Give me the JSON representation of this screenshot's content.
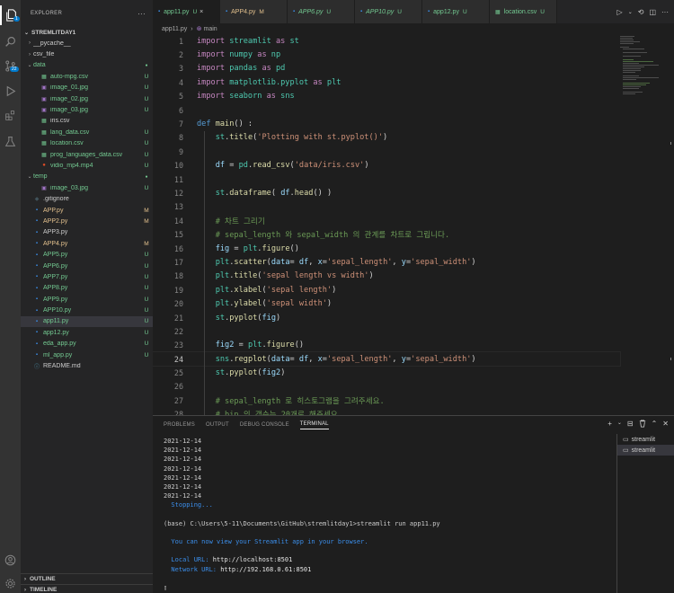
{
  "activity_bar": {
    "items": [
      {
        "icon": "files-icon"
      },
      {
        "icon": "search-icon"
      },
      {
        "icon": "source-control-icon",
        "badge": "22"
      },
      {
        "icon": "run-debug-icon"
      },
      {
        "icon": "extensions-icon"
      },
      {
        "icon": "flask-icon"
      }
    ],
    "bottom": [
      {
        "icon": "account-icon"
      },
      {
        "icon": "settings-gear-icon"
      }
    ]
  },
  "explorer": {
    "title": "EXPLORER",
    "project": "STREMLITDAY1",
    "tree": [
      {
        "depth": 1,
        "caret": "›",
        "name": "__pycache__",
        "kind": "folder",
        "color": "#ccc",
        "badge": ""
      },
      {
        "depth": 1,
        "caret": "›",
        "name": "csv_file",
        "kind": "folder",
        "color": "#ccc",
        "badge": ""
      },
      {
        "depth": 1,
        "caret": "⌄",
        "name": "data",
        "kind": "folder",
        "color": "#73c991",
        "badge": "●"
      },
      {
        "depth": 2,
        "caret": "",
        "name": "auto-mpg.csv",
        "kind": "csv",
        "color": "#73c991",
        "badge": "U"
      },
      {
        "depth": 2,
        "caret": "",
        "name": "image_01.jpg",
        "kind": "img",
        "color": "#73c991",
        "badge": "U"
      },
      {
        "depth": 2,
        "caret": "",
        "name": "image_02.jpg",
        "kind": "img",
        "color": "#73c991",
        "badge": "U"
      },
      {
        "depth": 2,
        "caret": "",
        "name": "image_03.jpg",
        "kind": "img",
        "color": "#73c991",
        "badge": "U"
      },
      {
        "depth": 2,
        "caret": "",
        "name": "iris.csv",
        "kind": "csv",
        "color": "#ccc",
        "badge": ""
      },
      {
        "depth": 2,
        "caret": "",
        "name": "lang_data.csv",
        "kind": "csv",
        "color": "#73c991",
        "badge": "U"
      },
      {
        "depth": 2,
        "caret": "",
        "name": "location.csv",
        "kind": "csv",
        "color": "#73c991",
        "badge": "U"
      },
      {
        "depth": 2,
        "caret": "",
        "name": "prog_languages_data.csv",
        "kind": "csv",
        "color": "#73c991",
        "badge": "U"
      },
      {
        "depth": 2,
        "caret": "",
        "name": "vidio_mp4.mp4",
        "kind": "vid",
        "color": "#73c991",
        "badge": "U"
      },
      {
        "depth": 1,
        "caret": "⌄",
        "name": "temp",
        "kind": "folder",
        "color": "#73c991",
        "badge": "●"
      },
      {
        "depth": 2,
        "caret": "",
        "name": "image_03.jpg",
        "kind": "img",
        "color": "#73c991",
        "badge": "U"
      },
      {
        "depth": 1,
        "caret": "",
        "name": ".gitignore",
        "kind": "git",
        "color": "#ccc",
        "badge": ""
      },
      {
        "depth": 1,
        "caret": "",
        "name": "APP.py",
        "kind": "py",
        "color": "#e2c08d",
        "badge": "M"
      },
      {
        "depth": 1,
        "caret": "",
        "name": "APP2.py",
        "kind": "py",
        "color": "#e2c08d",
        "badge": "M"
      },
      {
        "depth": 1,
        "caret": "",
        "name": "APP3.py",
        "kind": "py",
        "color": "#ccc",
        "badge": ""
      },
      {
        "depth": 1,
        "caret": "",
        "name": "APP4.py",
        "kind": "py",
        "color": "#e2c08d",
        "badge": "M"
      },
      {
        "depth": 1,
        "caret": "",
        "name": "APP5.py",
        "kind": "py",
        "color": "#73c991",
        "badge": "U"
      },
      {
        "depth": 1,
        "caret": "",
        "name": "APP6.py",
        "kind": "py",
        "color": "#73c991",
        "badge": "U"
      },
      {
        "depth": 1,
        "caret": "",
        "name": "APP7.py",
        "kind": "py",
        "color": "#73c991",
        "badge": "U"
      },
      {
        "depth": 1,
        "caret": "",
        "name": "APP8.py",
        "kind": "py",
        "color": "#73c991",
        "badge": "U"
      },
      {
        "depth": 1,
        "caret": "",
        "name": "APP9.py",
        "kind": "py",
        "color": "#73c991",
        "badge": "U"
      },
      {
        "depth": 1,
        "caret": "",
        "name": "APP10.py",
        "kind": "py",
        "color": "#73c991",
        "badge": "U"
      },
      {
        "depth": 1,
        "caret": "",
        "name": "app11.py",
        "kind": "py",
        "color": "#73c991",
        "badge": "U",
        "selected": true
      },
      {
        "depth": 1,
        "caret": "",
        "name": "app12.py",
        "kind": "py",
        "color": "#73c991",
        "badge": "U"
      },
      {
        "depth": 1,
        "caret": "",
        "name": "eda_app.py",
        "kind": "py",
        "color": "#73c991",
        "badge": "U"
      },
      {
        "depth": 1,
        "caret": "",
        "name": "ml_app.py",
        "kind": "py",
        "color": "#73c991",
        "badge": "U"
      },
      {
        "depth": 1,
        "caret": "",
        "name": "README.md",
        "kind": "info",
        "color": "#ccc",
        "badge": ""
      }
    ],
    "outline": "OUTLINE",
    "timeline": "TIMELINE"
  },
  "tabs": [
    {
      "label": "app11.py",
      "status": "U",
      "active": true,
      "close": "×"
    },
    {
      "label": "APP4.py",
      "status": "M",
      "active": false,
      "close": ""
    },
    {
      "label": "APP6.py",
      "status": "U",
      "active": false,
      "close": ""
    },
    {
      "label": "APP10.py",
      "status": "U",
      "active": false,
      "close": ""
    },
    {
      "label": "app12.py",
      "status": "U",
      "active": false,
      "close": ""
    },
    {
      "label": "location.csv",
      "status": "U",
      "active": false,
      "close": ""
    }
  ],
  "breadcrumb": {
    "file": "app11.py",
    "sep": "›",
    "symbol": "main"
  },
  "code": {
    "lines": [
      {
        "n": "1",
        "toks": [
          [
            "kw",
            "import "
          ],
          [
            "mod",
            "streamlit"
          ],
          [
            "kw",
            " as "
          ],
          [
            "mod",
            "st"
          ]
        ]
      },
      {
        "n": "2",
        "toks": [
          [
            "kw",
            "import "
          ],
          [
            "mod",
            "numpy"
          ],
          [
            "kw",
            " as "
          ],
          [
            "mod",
            "np"
          ]
        ]
      },
      {
        "n": "3",
        "toks": [
          [
            "kw",
            "import "
          ],
          [
            "mod",
            "pandas"
          ],
          [
            "kw",
            " as "
          ],
          [
            "mod",
            "pd"
          ]
        ]
      },
      {
        "n": "4",
        "toks": [
          [
            "kw",
            "import "
          ],
          [
            "mod",
            "matplotlib.pyplot"
          ],
          [
            "kw",
            " as "
          ],
          [
            "mod",
            "plt"
          ]
        ]
      },
      {
        "n": "5",
        "toks": [
          [
            "kw",
            "import "
          ],
          [
            "mod",
            "seaborn"
          ],
          [
            "kw",
            " as "
          ],
          [
            "mod",
            "sns"
          ]
        ]
      },
      {
        "n": "6",
        "toks": []
      },
      {
        "n": "7",
        "toks": [
          [
            "def",
            "def "
          ],
          [
            "fn",
            "main"
          ],
          [
            "id",
            "() :"
          ]
        ]
      },
      {
        "n": "8",
        "toks": [
          [
            "id",
            "    "
          ],
          [
            "mod",
            "st"
          ],
          [
            "id",
            "."
          ],
          [
            "fn",
            "title"
          ],
          [
            "id",
            "("
          ],
          [
            "str",
            "'Plotting with st.pyplot()'"
          ],
          [
            "id",
            ")"
          ]
        ]
      },
      {
        "n": "9",
        "toks": []
      },
      {
        "n": "10",
        "toks": [
          [
            "id",
            "    "
          ],
          [
            "var",
            "df"
          ],
          [
            "id",
            " = "
          ],
          [
            "mod",
            "pd"
          ],
          [
            "id",
            "."
          ],
          [
            "fn",
            "read_csv"
          ],
          [
            "id",
            "("
          ],
          [
            "str",
            "'data/iris.csv'"
          ],
          [
            "id",
            ")"
          ]
        ]
      },
      {
        "n": "11",
        "toks": []
      },
      {
        "n": "12",
        "toks": [
          [
            "id",
            "    "
          ],
          [
            "mod",
            "st"
          ],
          [
            "id",
            "."
          ],
          [
            "fn",
            "dataframe"
          ],
          [
            "id",
            "( "
          ],
          [
            "var",
            "df"
          ],
          [
            "id",
            "."
          ],
          [
            "fn",
            "head"
          ],
          [
            "id",
            "() )"
          ]
        ]
      },
      {
        "n": "13",
        "toks": []
      },
      {
        "n": "14",
        "toks": [
          [
            "cm",
            "    # 차트 그리기"
          ]
        ]
      },
      {
        "n": "15",
        "toks": [
          [
            "cm",
            "    # sepal_length 와 sepal_width 의 관계를 차트로 그립니다."
          ]
        ]
      },
      {
        "n": "16",
        "toks": [
          [
            "id",
            "    "
          ],
          [
            "var",
            "fig"
          ],
          [
            "id",
            " = "
          ],
          [
            "mod",
            "plt"
          ],
          [
            "id",
            "."
          ],
          [
            "fn",
            "figure"
          ],
          [
            "id",
            "()"
          ]
        ]
      },
      {
        "n": "17",
        "toks": [
          [
            "id",
            "    "
          ],
          [
            "mod",
            "plt"
          ],
          [
            "id",
            "."
          ],
          [
            "fn",
            "scatter"
          ],
          [
            "id",
            "("
          ],
          [
            "var",
            "data"
          ],
          [
            "id",
            "= "
          ],
          [
            "var",
            "df"
          ],
          [
            "id",
            ", "
          ],
          [
            "var",
            "x"
          ],
          [
            "id",
            "="
          ],
          [
            "str",
            "'sepal_length'"
          ],
          [
            "id",
            ", "
          ],
          [
            "var",
            "y"
          ],
          [
            "id",
            "="
          ],
          [
            "str",
            "'sepal_width'"
          ],
          [
            "id",
            ")"
          ]
        ]
      },
      {
        "n": "18",
        "toks": [
          [
            "id",
            "    "
          ],
          [
            "mod",
            "plt"
          ],
          [
            "id",
            "."
          ],
          [
            "fn",
            "title"
          ],
          [
            "id",
            "("
          ],
          [
            "str",
            "'sepal length vs width'"
          ],
          [
            "id",
            ")"
          ]
        ]
      },
      {
        "n": "19",
        "toks": [
          [
            "id",
            "    "
          ],
          [
            "mod",
            "plt"
          ],
          [
            "id",
            "."
          ],
          [
            "fn",
            "xlabel"
          ],
          [
            "id",
            "("
          ],
          [
            "str",
            "'sepal length'"
          ],
          [
            "id",
            ")"
          ]
        ]
      },
      {
        "n": "20",
        "toks": [
          [
            "id",
            "    "
          ],
          [
            "mod",
            "plt"
          ],
          [
            "id",
            "."
          ],
          [
            "fn",
            "ylabel"
          ],
          [
            "id",
            "("
          ],
          [
            "str",
            "'sepal width'"
          ],
          [
            "id",
            ")"
          ]
        ]
      },
      {
        "n": "21",
        "toks": [
          [
            "id",
            "    "
          ],
          [
            "mod",
            "st"
          ],
          [
            "id",
            "."
          ],
          [
            "fn",
            "pyplot"
          ],
          [
            "id",
            "("
          ],
          [
            "var",
            "fig"
          ],
          [
            "id",
            ")"
          ]
        ]
      },
      {
        "n": "22",
        "toks": []
      },
      {
        "n": "23",
        "toks": [
          [
            "id",
            "    "
          ],
          [
            "var",
            "fig2"
          ],
          [
            "id",
            " = "
          ],
          [
            "mod",
            "plt"
          ],
          [
            "id",
            "."
          ],
          [
            "fn",
            "figure"
          ],
          [
            "id",
            "()"
          ]
        ]
      },
      {
        "n": "24",
        "cur": true,
        "toks": [
          [
            "id",
            "    "
          ],
          [
            "mod",
            "sns"
          ],
          [
            "id",
            "."
          ],
          [
            "fn",
            "regplot"
          ],
          [
            "id",
            "("
          ],
          [
            "var",
            "data"
          ],
          [
            "id",
            "= "
          ],
          [
            "var",
            "df"
          ],
          [
            "id",
            ", "
          ],
          [
            "var",
            "x"
          ],
          [
            "id",
            "="
          ],
          [
            "str",
            "'sepal_length'"
          ],
          [
            "id",
            ", "
          ],
          [
            "var",
            "y"
          ],
          [
            "id",
            "="
          ],
          [
            "str",
            "'sepal_width'"
          ],
          [
            "id",
            ")"
          ]
        ]
      },
      {
        "n": "25",
        "toks": [
          [
            "id",
            "    "
          ],
          [
            "mod",
            "st"
          ],
          [
            "id",
            "."
          ],
          [
            "fn",
            "pyplot"
          ],
          [
            "id",
            "("
          ],
          [
            "var",
            "fig2"
          ],
          [
            "id",
            ")"
          ]
        ]
      },
      {
        "n": "26",
        "toks": []
      },
      {
        "n": "27",
        "toks": [
          [
            "cm",
            "    # sepal_length 로 히스토그램을 그려주세요."
          ]
        ]
      },
      {
        "n": "28",
        "toks": [
          [
            "cm",
            "    # bin 의 갯수는 20개로 해주세요."
          ]
        ]
      }
    ]
  },
  "panel": {
    "tabs": [
      "PROBLEMS",
      "OUTPUT",
      "DEBUG CONSOLE",
      "TERMINAL"
    ],
    "active_tab": "TERMINAL",
    "actions": [
      "+",
      "⌄",
      "⊟",
      "🗑",
      "⌃",
      "✕"
    ],
    "terminal_lines": [
      {
        "t": "2021-12-14",
        "c": ""
      },
      {
        "t": "2021-12-14",
        "c": ""
      },
      {
        "t": "2021-12-14",
        "c": ""
      },
      {
        "t": "2021-12-14",
        "c": ""
      },
      {
        "t": "2021-12-14",
        "c": ""
      },
      {
        "t": "2021-12-14",
        "c": ""
      },
      {
        "t": "2021-12-14",
        "c": ""
      },
      {
        "t": "  Stopping...",
        "c": "blue"
      },
      {
        "t": "",
        "c": ""
      },
      {
        "t": "(base) C:\\Users\\5-11\\Documents\\GitHub\\stremlitday1>streamlit run app11.py",
        "c": ""
      },
      {
        "t": "",
        "c": ""
      },
      {
        "t": "  You can now view your Streamlit app in your browser.",
        "c": "blue"
      },
      {
        "t": "",
        "c": ""
      },
      {
        "t": "  Local URL: http://localhost:8501",
        "c": "mix1"
      },
      {
        "t": "  Network URL: http://192.168.0.61:8501",
        "c": "mix2"
      },
      {
        "t": "",
        "c": ""
      },
      {
        "t": "▯",
        "c": ""
      }
    ],
    "terminals": [
      {
        "label": "streamlit",
        "active": false
      },
      {
        "label": "streamlit",
        "active": true
      }
    ]
  },
  "colors": {
    "accent": "#007acc",
    "untracked": "#73c991",
    "modified": "#e2c08d"
  }
}
